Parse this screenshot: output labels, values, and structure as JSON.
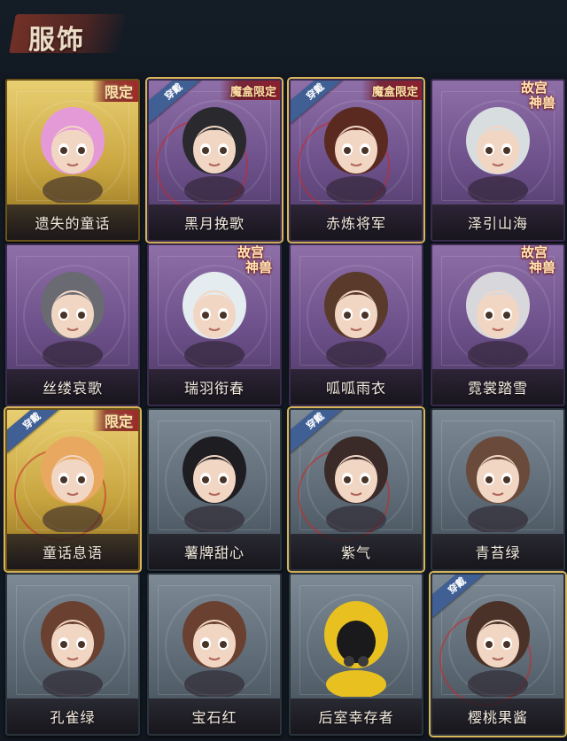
{
  "header": {
    "title": "服饰"
  },
  "tags": {
    "equipped": "穿戴",
    "limited": "限定",
    "mystery_box_limited": "魔盒限定",
    "gugong_line1": "故宫",
    "gugong_line2": "神兽"
  },
  "items": [
    {
      "name": "遗失的童话",
      "frame": "gold",
      "tags": [
        "limited"
      ]
    },
    {
      "name": "黑月挽歌",
      "frame": "purple",
      "tags": [
        "equipped",
        "mystery_box_limited"
      ]
    },
    {
      "name": "赤炼将军",
      "frame": "purple",
      "tags": [
        "equipped",
        "mystery_box_limited"
      ]
    },
    {
      "name": "泽引山海",
      "frame": "purple",
      "tags": [
        "gugong"
      ]
    },
    {
      "name": "丝缕哀歌",
      "frame": "purple",
      "tags": []
    },
    {
      "name": "瑞羽衔春",
      "frame": "purple",
      "tags": [
        "gugong"
      ]
    },
    {
      "name": "呱呱雨衣",
      "frame": "purple",
      "tags": []
    },
    {
      "name": "霓裳踏雪",
      "frame": "purple",
      "tags": [
        "gugong"
      ]
    },
    {
      "name": "童话息语",
      "frame": "gold",
      "tags": [
        "equipped",
        "limited"
      ]
    },
    {
      "name": "薯牌甜心",
      "frame": "gray",
      "tags": []
    },
    {
      "name": "紫气",
      "frame": "gray",
      "tags": [
        "equipped"
      ]
    },
    {
      "name": "青苔绿",
      "frame": "gray",
      "tags": []
    },
    {
      "name": "孔雀绿",
      "frame": "gray",
      "tags": []
    },
    {
      "name": "宝石红",
      "frame": "gray",
      "tags": []
    },
    {
      "name": "后室幸存者",
      "frame": "gray",
      "tags": []
    },
    {
      "name": "樱桃果酱",
      "frame": "gray",
      "tags": [
        "equipped"
      ]
    }
  ],
  "colors": {
    "background": "#111821",
    "title_accent": "#7a3228",
    "equipped_tag": "#3f5f95",
    "limited_text": "#ffe3a8"
  }
}
